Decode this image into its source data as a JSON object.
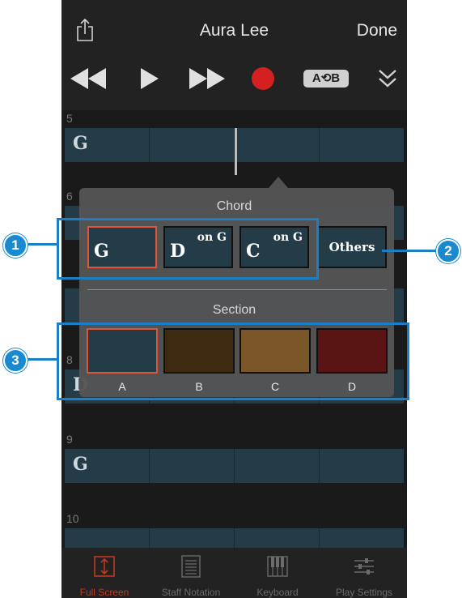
{
  "header": {
    "title": "Aura Lee",
    "done_label": "Done",
    "share_icon": "share-icon"
  },
  "transport": {
    "icons": [
      "rewind-icon",
      "play-icon",
      "fast-forward-icon",
      "record-icon",
      "ab-repeat-icon",
      "collapse-chevron-icon"
    ],
    "ab_label": "A⟲B",
    "record_color": "#d42020"
  },
  "score": {
    "measures": [
      {
        "number": "5",
        "chord": "G"
      },
      {
        "number": "6",
        "chord": ""
      },
      {
        "number": "8",
        "chord": "D"
      },
      {
        "number": "9",
        "chord": "G"
      },
      {
        "number": "10",
        "chord": ""
      }
    ]
  },
  "popup": {
    "chord_title": "Chord",
    "chords": [
      {
        "root": "G",
        "on": ""
      },
      {
        "root": "D",
        "on": "on G"
      },
      {
        "root": "C",
        "on": "on G"
      }
    ],
    "others_label": "Others",
    "section_title": "Section",
    "sections": [
      {
        "label": "A",
        "color": "#243c48"
      },
      {
        "label": "B",
        "color": "#3e2a10"
      },
      {
        "label": "C",
        "color": "#7a5628"
      },
      {
        "label": "D",
        "color": "#5a1414"
      }
    ]
  },
  "callouts": [
    "1",
    "2",
    "3"
  ],
  "tabs": [
    {
      "label": "Full Screen",
      "icon": "full-screen-icon"
    },
    {
      "label": "Staff Notation",
      "icon": "staff-notation-icon"
    },
    {
      "label": "Keyboard",
      "icon": "keyboard-icon"
    },
    {
      "label": "Play Settings",
      "icon": "play-settings-icon"
    }
  ],
  "colors": {
    "accent": "#c0391f",
    "callout": "#1c7fc6"
  }
}
